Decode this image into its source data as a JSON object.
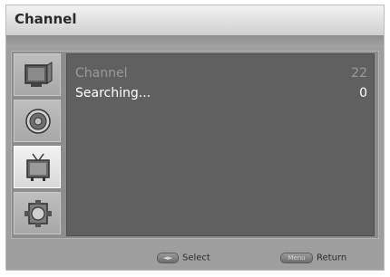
{
  "window": {
    "title": "Channel"
  },
  "sidebar": {
    "items": [
      {
        "icon": "picture-icon",
        "active": false
      },
      {
        "icon": "sound-icon",
        "active": false
      },
      {
        "icon": "channel-tv-icon",
        "active": true
      },
      {
        "icon": "setup-icon",
        "active": false
      }
    ]
  },
  "menu": {
    "rows": [
      {
        "label": "Channel",
        "value": "22",
        "state": "dim"
      },
      {
        "label": "Searching...",
        "value": "0",
        "state": "bright"
      }
    ]
  },
  "footer": {
    "select": {
      "key": "◄►",
      "label": "Select"
    },
    "return": {
      "key": "Menu",
      "label": "Return"
    }
  }
}
